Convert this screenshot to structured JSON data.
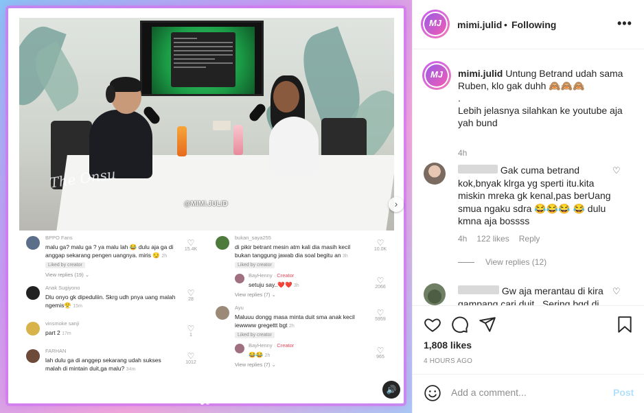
{
  "post": {
    "video_watermark": "@MIMI.JULID",
    "video_brand": "The Onsu",
    "tiktok_comments_left": [
      {
        "name": "BPPO Fans",
        "text": "malu ga? malu ga ? ya malu lah 😂 dulu aja ga di anggap sekarang pengen uangnya. miris 😏",
        "time": "2h",
        "liked": "Liked by creator",
        "likes": "15.4K",
        "replies": "View replies (19)"
      },
      {
        "name": "Anak Sugiyono",
        "text": "Dlu onyo gk dipeduliin. Skrg udh pnya uang malah ngemis😤",
        "time": "15m",
        "likes": "28"
      },
      {
        "name": "vinsmoke sanji",
        "text": "part 2",
        "time": "17m",
        "likes": "1"
      },
      {
        "name": "FARHAN",
        "text": "lah dulu ga di anggep sekarang udah sukses malah di mintain duit,ga malu?",
        "time": "34m",
        "likes": "1012"
      }
    ],
    "tiktok_comments_right": [
      {
        "name": "bukan_saya255",
        "text": "di pikir betrant mesin atm kali dia masih kecil bukan tanggung jawab dia soal begitu an",
        "time": "3h",
        "liked": "Liked by creator",
        "likes": "10.0K"
      },
      {
        "name": "BayHenny",
        "creator": "Creator",
        "text": "setuju say..❤️❤️",
        "time": "3h",
        "likes": "2066",
        "replies": "View replies (7)"
      },
      {
        "name": "Ayu",
        "text": "Maluuu dongg masa minta duit sma anak kecil iewwww gregettt bgt",
        "time": "2h",
        "liked": "Liked by creator",
        "likes": "5959"
      },
      {
        "name": "BayHenny",
        "creator": "Creator",
        "text": "😂😂",
        "time": "2h",
        "likes": "965",
        "replies": "View replies (7)"
      }
    ],
    "separator": "·"
  },
  "header": {
    "username": "mimi.julid",
    "avatar_text": "MJ",
    "separator": "•",
    "follow_status": "Following",
    "more_icon": "more-horizontal-icon"
  },
  "caption": {
    "username": "mimi.julid",
    "text_line1": " Untung Betrand udah sama Ruben, klo gak duhh 🙈🙈🙈",
    "text_line2": ".",
    "text_line3": "Lebih jelasnya silahkan ke youtube aja yah bund",
    "time": "4h"
  },
  "comments": [
    {
      "text": "Gak cuma betrand kok,bnyak klrga yg sperti itu.kita miskin mreka gk kenal,pas berUang smua ngaku sdra 😂😂😂 😂 dulu kmna aja bossss",
      "time": "4h",
      "likes": "122 likes",
      "reply": "Reply",
      "view_replies": "View replies (12)"
    },
    {
      "text": "Gw aja merantau di kira gampang cari duit . Sering bgd di"
    }
  ],
  "actions": {
    "likes": "1,808 likes",
    "posted": "4 HOURS AGO"
  },
  "add_comment": {
    "placeholder": "Add a comment...",
    "post_label": "Post"
  },
  "colors": {
    "accent": "#0095f6",
    "post_disabled": "#b2dffc",
    "muted": "#8e8e8e",
    "creator": "#e8455a"
  }
}
